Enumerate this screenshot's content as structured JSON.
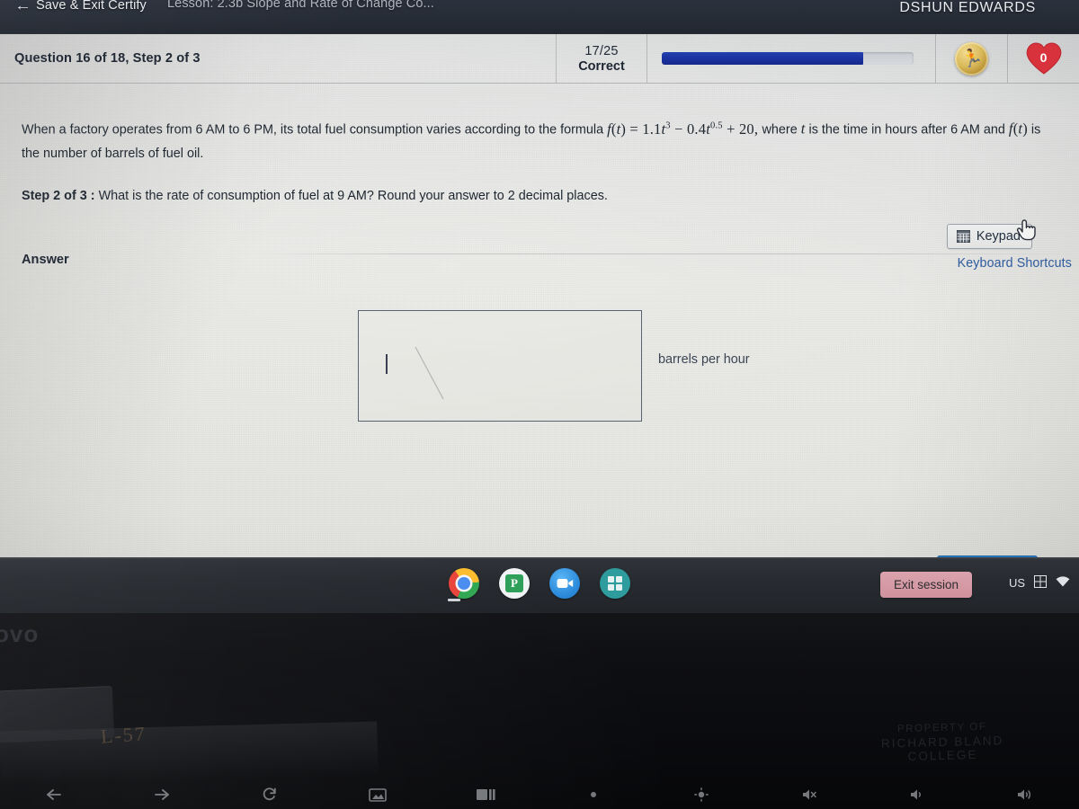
{
  "browser": {
    "exit_label": "Save & Exit Certify",
    "back_arrow": "←",
    "tab_title": "Lesson: 2.3b Slope and Rate of Change Co...",
    "user_name": "DSHUN EDWARDS"
  },
  "status": {
    "question_label": "Question 16 of 18, Step 2 of 3",
    "score_fraction": "17/25",
    "score_word": "Correct",
    "progress_percent": 80,
    "coin_icon": "medal-icon",
    "hearts_count": "0",
    "heart_color": "#d8323c",
    "progress_color": "#1b32a0"
  },
  "question": {
    "intro_a": "When a factory operates from 6 AM to 6 PM, its total fuel consumption varies according to the formula",
    "formula": {
      "fn": "f",
      "var": "t",
      "equals": "=",
      "term1_coef": "1.1",
      "term1_var": "t",
      "term1_exp": "3",
      "minus": "−",
      "term2_coef": "0.4",
      "term2_var": "t",
      "term2_exp": "0.5",
      "plus": "+",
      "term3": "20",
      "comma": ","
    },
    "intro_b": "where",
    "intro_c": "is the time in hours after 6 AM and",
    "intro_d": "is the number of barrels of fuel oil.",
    "step_label": "Step 2 of 3 :",
    "step_question": "What is the rate of consumption of fuel at 9 AM? Round your answer to 2 decimal places."
  },
  "answer": {
    "section_label": "Answer",
    "keypad_label": "Keypad",
    "keypad_icon": "calculator-grid-icon",
    "shortcuts_label": "Keyboard Shortcuts",
    "input_value": "",
    "input_placeholder": "",
    "unit_label": "barrels per hour",
    "submit_label": ""
  },
  "shelf": {
    "apps": [
      {
        "name": "chrome-icon",
        "label": "Chrome"
      },
      {
        "name": "pear-deck-icon",
        "label": "P"
      },
      {
        "name": "zoom-icon",
        "label": "Zoom"
      },
      {
        "name": "apps-grid-icon",
        "label": "Apps"
      }
    ],
    "exit_session_label": "Exit session",
    "ime_label": "US",
    "ime_icon": "ime-icon",
    "wifi_icon": "wifi-icon"
  },
  "hardware": {
    "brand": "ovo",
    "asset_tag": "L-57",
    "property_line1": "PROPERTY OF",
    "property_line2": "RICHARD BLAND",
    "property_line3": "COLLEGE",
    "function_keys": [
      "back-arrow-key",
      "forward-arrow-key",
      "refresh-key",
      "fullscreen-key",
      "overview-key",
      "brightness-down-key",
      "brightness-up-key",
      "mute-key",
      "volume-down-key",
      "volume-up-key"
    ]
  },
  "cursor": {
    "type": "pointer-hand"
  }
}
